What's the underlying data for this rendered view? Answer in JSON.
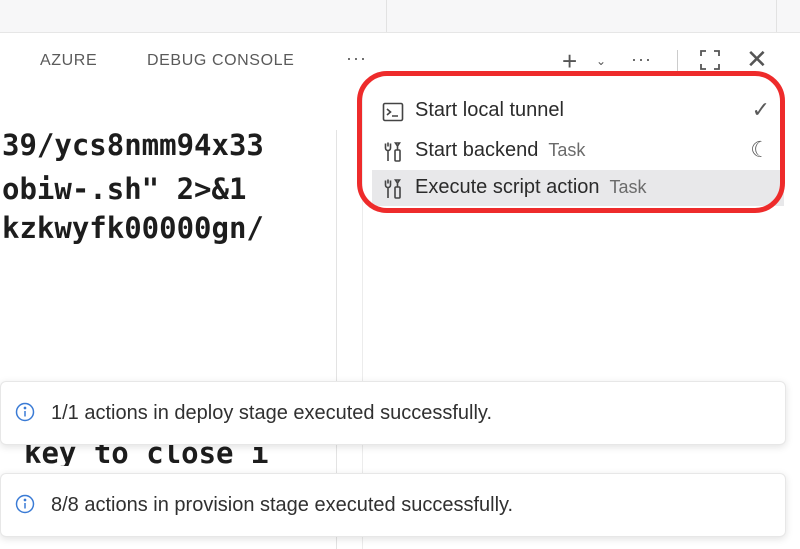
{
  "panel": {
    "tabs": [
      {
        "label": "AZURE"
      },
      {
        "label": "DEBUG CONSOLE"
      }
    ],
    "more_label": "···"
  },
  "header_icons": {
    "plus": "+",
    "chevron": "⌄",
    "more": "···",
    "close": "✕"
  },
  "terminal": {
    "lines": [
      "39/ycs8nmm94x33",
      "obiw-.sh\" 2>&1",
      "kzkwyfk00000gn/"
    ],
    "peek": "key to close i"
  },
  "tasks": [
    {
      "label": "Start local tunnel",
      "tag": "",
      "status": "✓",
      "icon": "terminal-icon"
    },
    {
      "label": "Start backend",
      "tag": "Task",
      "status": "☾",
      "icon": "tools-icon"
    },
    {
      "label": "Execute script action",
      "tag": "Task",
      "status": "",
      "icon": "tools-icon"
    }
  ],
  "notifications": [
    {
      "text": "1/1 actions in deploy stage executed successfully.",
      "icon": "info-icon"
    },
    {
      "text": "8/8 actions in provision stage executed successfully.",
      "icon": "info-icon"
    }
  ],
  "colors": {
    "highlight": "#ee2b2b",
    "info": "#3a7bd5",
    "selected_row": "#e8e8ea"
  }
}
